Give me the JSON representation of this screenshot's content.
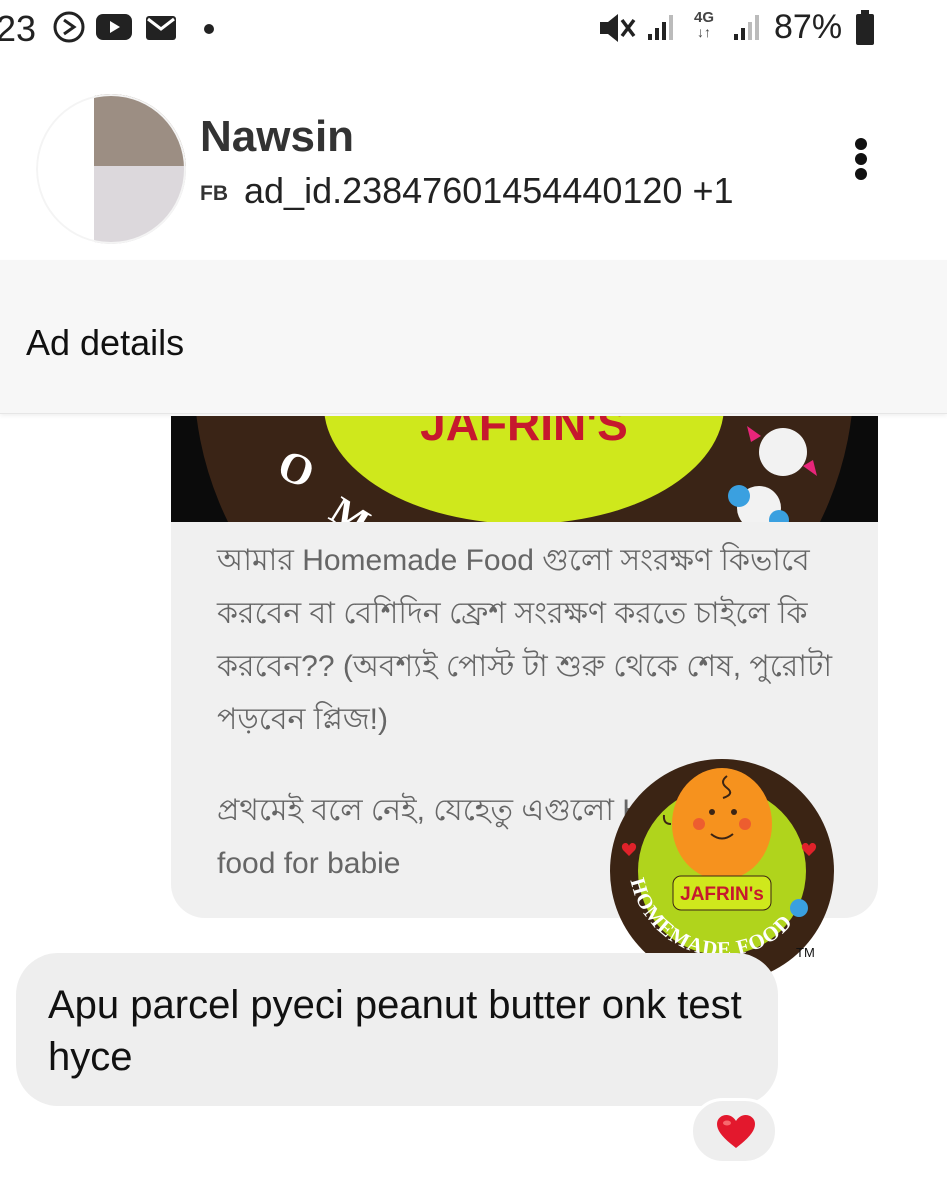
{
  "status_bar": {
    "time": "23",
    "left_icons": [
      "data-saver-icon",
      "youtube-icon",
      "mail-icon",
      "dot-icon"
    ],
    "right_icons": [
      "mute-icon",
      "signal-icon",
      "network-4g-icon",
      "signal-icon",
      "battery-icon"
    ],
    "network_label": "4G",
    "battery": "87%"
  },
  "header": {
    "contact_name": "Nawsin",
    "source_tag": "FB",
    "ad_id": "ad_id.23847601454440120 +1",
    "menu_icon": "more-vert-icon"
  },
  "ad_details": {
    "label": "Ad details"
  },
  "ad_card": {
    "banner_text": "JAFRIN'S",
    "paragraphs": [
      "আমার Homemade Food গুলো সংরক্ষণ কিভাবে করবেন বা বেশিদিন ফ্রেশ সংরক্ষণ করতে চাইলে কি করবেন?? (অবশ্যই পোস্ট টা শুরু থেকে শেষ, পুরোটা পড়বেন প্লিজ!)",
      "প্রথমেই বলে নেই, যেহেতু এগুলো Homemade food for babie"
    ]
  },
  "logo": {
    "brand": "JAFRIN's",
    "ring_text": "HOMEMADE FOOD",
    "trademark": "TM"
  },
  "message": {
    "text": "Apu parcel pyeci peanut butter onk test hyce",
    "reaction": "❤️"
  }
}
